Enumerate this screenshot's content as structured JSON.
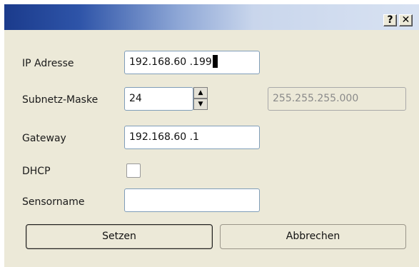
{
  "titlebar": {
    "help_label": "?",
    "close_label": "✕",
    "gradient_start": "#1b3b8c",
    "gradient_end": "#d8e2f2"
  },
  "form": {
    "ip": {
      "label": "IP Adresse",
      "value": "192.168.60 .199"
    },
    "subnet": {
      "label": "Subnetz-Maske",
      "value": "24",
      "mask_display": "255.255.255.000",
      "spin_up": "▲",
      "spin_down": "▼"
    },
    "gateway": {
      "label": "Gateway",
      "value": "192.168.60 .1"
    },
    "dhcp": {
      "label": "DHCP",
      "checked": false
    },
    "sensorname": {
      "label": "Sensorname",
      "value": ""
    }
  },
  "buttons": {
    "set_label": "Setzen",
    "cancel_label": "Abbrechen"
  }
}
